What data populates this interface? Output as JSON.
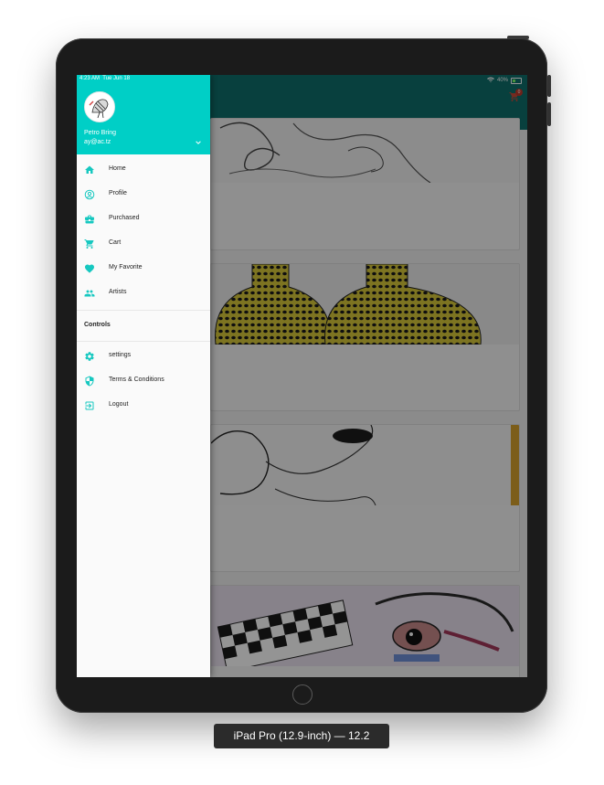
{
  "status_bar": {
    "time": "4:23 AM",
    "date": "Tue Jun 18",
    "battery": "40%"
  },
  "user": {
    "name": "Petro Bring",
    "email": "ay@ac.tz"
  },
  "drawer": {
    "menu": [
      {
        "label": "Home",
        "icon": "home-icon"
      },
      {
        "label": "Profile",
        "icon": "account-circle-icon"
      },
      {
        "label": "Purchased",
        "icon": "briefcase-icon"
      },
      {
        "label": "Cart",
        "icon": "cart-icon"
      },
      {
        "label": "My Favorite",
        "icon": "heart-icon"
      },
      {
        "label": "Artists",
        "icon": "people-icon"
      }
    ],
    "controls_title": "Controls",
    "controls": [
      {
        "label": "settings",
        "icon": "gear-icon"
      },
      {
        "label": "Terms & Conditions",
        "icon": "shield-icon"
      },
      {
        "label": "Logout",
        "icon": "logout-icon"
      }
    ]
  },
  "appbar": {
    "cart_badge": "0"
  },
  "colors": {
    "drawer_header": "#00cfc6",
    "appbar": "#0e6f6b",
    "icon_accent": "#16c8c0"
  },
  "device_caption": "iPad Pro (12.9-inch) — 12.2"
}
